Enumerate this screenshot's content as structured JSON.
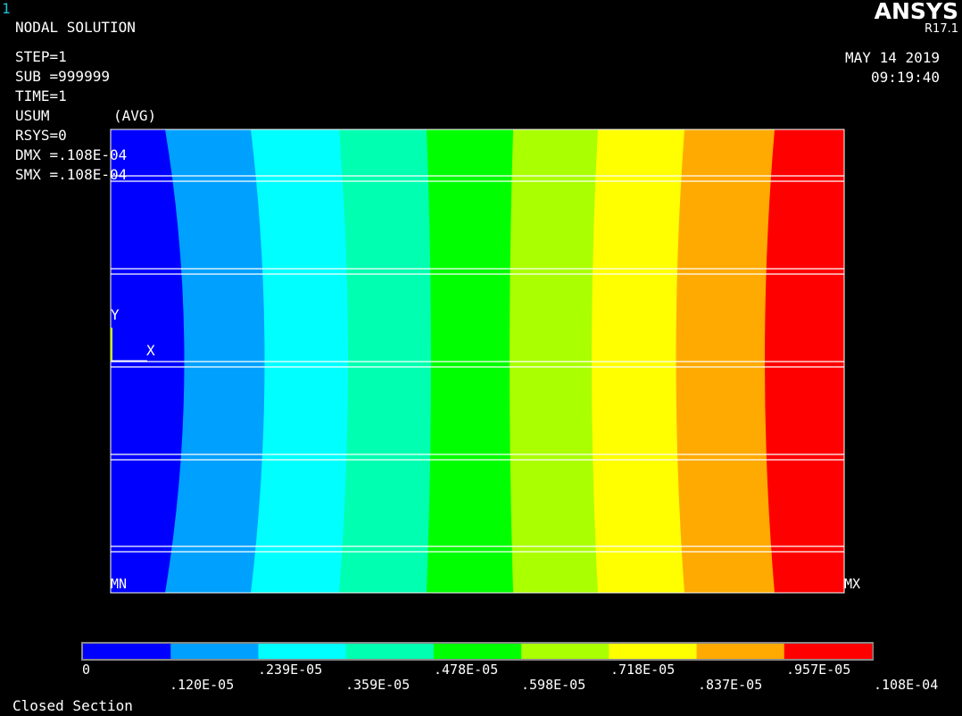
{
  "window_number": "1",
  "header": {
    "title": "NODAL SOLUTION",
    "step": "STEP=1",
    "sub": "SUB =999999",
    "time": "TIME=1",
    "usum": "USUM",
    "avg": "(AVG)",
    "rsys": "RSYS=0",
    "dmx": "DMX =.108E-04",
    "smx": "SMX =.108E-04"
  },
  "logo": {
    "brand": "ANSYS",
    "version": "R17.1"
  },
  "datetime": {
    "date": "MAY 14 2019",
    "time": "09:19:40"
  },
  "triad": {
    "y_label": "Y",
    "x_label": "X"
  },
  "plot": {
    "min_marker": "MN",
    "max_marker": "MX"
  },
  "contour_colors": [
    "#0000ff",
    "#00a0ff",
    "#00ffff",
    "#00ffb0",
    "#00ff00",
    "#aaff00",
    "#ffff00",
    "#ffaa00",
    "#ff0000"
  ],
  "colorbar": {
    "top_labels": [
      "0",
      ".239E-05",
      ".478E-05",
      ".718E-05",
      ".957E-05"
    ],
    "bottom_labels": [
      ".120E-05",
      ".359E-05",
      ".598E-05",
      ".837E-05",
      ".108E-04"
    ]
  },
  "footer": "Closed Section"
}
